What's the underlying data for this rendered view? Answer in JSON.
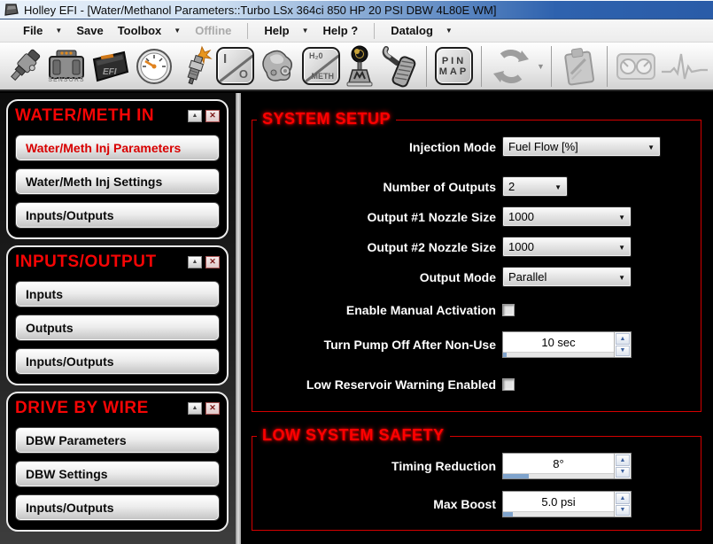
{
  "window": {
    "title": "Holley EFI - [Water/Methanol Parameters::Turbo LSx 364ci 850 HP 20 PSI DBW 4L80E WM]"
  },
  "menu": {
    "items": [
      {
        "label": "File",
        "has_arrow": true
      },
      {
        "label": "Save",
        "has_arrow": false
      },
      {
        "label": "Toolbox",
        "has_arrow": true
      },
      {
        "label": "Offline",
        "has_arrow": false,
        "disabled": true
      },
      {
        "label": "Help",
        "has_arrow": true
      },
      {
        "label": "Help ?",
        "has_arrow": false
      },
      {
        "label": "Datalog",
        "has_arrow": true
      }
    ]
  },
  "toolbar": {
    "icons": [
      "fuel-injector",
      "sensors",
      "efi-ecu",
      "gauge",
      "spark-plug",
      "io-button",
      "pump",
      "h2o-meth-button",
      "shifter",
      "pedal",
      "pin-map-button",
      "sync",
      "clipboard",
      "dash-gauges",
      "heartbeat"
    ],
    "disabled_icons": [
      "sync",
      "clipboard",
      "dash-gauges",
      "heartbeat"
    ],
    "sensors_label": "SENSORS",
    "efi_label": "EFI",
    "io_top": "I",
    "io_bottom": "O",
    "h2o_top": "H₂0",
    "h2o_bottom": "METH",
    "pinmap_top": "PIN",
    "pinmap_bottom": "MAP"
  },
  "sidebar": {
    "panels": [
      {
        "title": "WATER/METH IN",
        "items": [
          {
            "label": "Water/Meth Inj Parameters",
            "active": true
          },
          {
            "label": "Water/Meth Inj Settings",
            "active": false
          },
          {
            "label": "Inputs/Outputs",
            "active": false
          }
        ]
      },
      {
        "title": "INPUTS/OUTPUT",
        "items": [
          {
            "label": "Inputs",
            "active": false
          },
          {
            "label": "Outputs",
            "active": false
          },
          {
            "label": "Inputs/Outputs",
            "active": false
          }
        ]
      },
      {
        "title": "DRIVE BY WIRE",
        "items": [
          {
            "label": "DBW Parameters",
            "active": false
          },
          {
            "label": "DBW Settings",
            "active": false
          },
          {
            "label": "Inputs/Outputs",
            "active": false
          }
        ]
      }
    ]
  },
  "main": {
    "system_setup": {
      "title": "SYSTEM SETUP",
      "fields": [
        {
          "label": "Injection Mode",
          "type": "select",
          "value": "Fuel Flow [%]"
        },
        {
          "label": "Number of Outputs",
          "type": "select",
          "value": "2"
        },
        {
          "label": "Output #1 Nozzle Size",
          "type": "select",
          "value": "1000"
        },
        {
          "label": "Output #2 Nozzle Size",
          "type": "select",
          "value": "1000"
        },
        {
          "label": "Output Mode",
          "type": "select",
          "value": "Parallel"
        },
        {
          "label": "Enable Manual Activation",
          "type": "checkbox",
          "checked": false
        },
        {
          "label": "Turn Pump Off After Non-Use",
          "type": "spinner",
          "value": "10 sec",
          "fill_pct": 3
        },
        {
          "label": "Low Reservoir Warning Enabled",
          "type": "checkbox",
          "checked": false
        }
      ]
    },
    "low_system_safety": {
      "title": "LOW SYSTEM SAFETY",
      "fields": [
        {
          "label": "Timing Reduction",
          "type": "spinner",
          "value": "8°",
          "fill_pct": 23
        },
        {
          "label": "Max Boost",
          "type": "spinner",
          "value": "5.0 psi",
          "fill_pct": 9
        }
      ]
    }
  },
  "colors": {
    "section_border_red": "#d40000",
    "section_title_red": "#ff0000",
    "active_item_red": "#d80000",
    "spinner_fill_blue": "#7fa3cc",
    "titlebar_blue": "#2e62ae"
  }
}
